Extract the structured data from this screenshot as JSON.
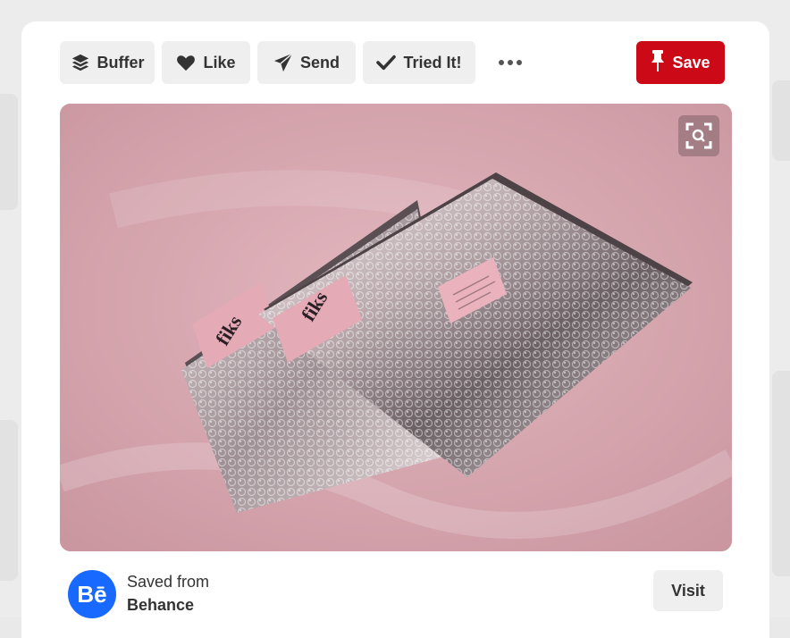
{
  "toolbar": {
    "buffer_label": "Buffer",
    "like_label": "Like",
    "send_label": "Send",
    "tried_label": "Tried It!",
    "save_label": "Save",
    "icons": {
      "buffer": "layers-icon",
      "like": "heart-icon",
      "send": "paper-plane-icon",
      "tried": "checkmark-icon",
      "more": "more-dots-icon",
      "save": "pushpin-icon"
    }
  },
  "pin": {
    "image_alt": "Silver bubble mailers with pink fiks labels on pink satin",
    "visual_search_icon": "visual-search-icon",
    "mailer_brand": "fiks"
  },
  "footer": {
    "avatar_text": "Bē",
    "saved_from_label": "Saved from",
    "source_name": "Behance",
    "visit_label": "Visit"
  },
  "colors": {
    "save_red": "#cc0a17",
    "behance_blue": "#1769ff",
    "button_gray": "#efefef",
    "photo_pink": "#d9a8b1"
  }
}
